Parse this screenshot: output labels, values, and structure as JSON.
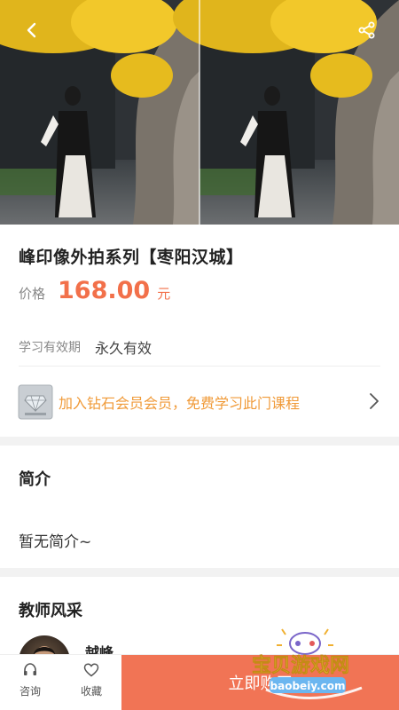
{
  "course": {
    "title": "峰印像外拍系列【枣阳汉城】",
    "price_label": "价格",
    "price": "168.00",
    "price_unit": "元",
    "validity_label": "学习有效期",
    "validity_value": "永久有效"
  },
  "vip_banner": {
    "text": "加入钻石会员会员，免费学习此门课程",
    "icon": "diamond-badge-icon"
  },
  "intro": {
    "title": "简介",
    "body": "暂无简介~"
  },
  "teacher": {
    "title": "教师风采",
    "name": "越峰"
  },
  "bottom_bar": {
    "consult_label": "咨询",
    "favorite_label": "收藏",
    "buy_label": "立即购买"
  },
  "watermark": {
    "text_cn": "宝贝游戏网",
    "text_url": "baobeiy.com"
  },
  "colors": {
    "accent": "#f2704a",
    "vip": "#f09a38",
    "buy_button": "#f17455"
  }
}
